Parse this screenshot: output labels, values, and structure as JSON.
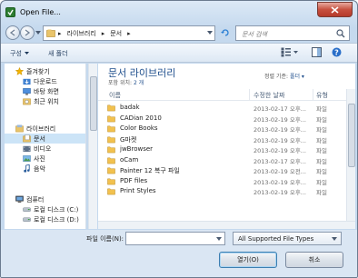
{
  "window": {
    "title": "Open File..."
  },
  "nav": {
    "breadcrumb": [
      "라이브러리",
      "문서"
    ],
    "search_placeholder": "문서 검색"
  },
  "toolbar": {
    "organize_label": "구성",
    "new_folder_label": "새 폴더"
  },
  "sidebar": {
    "favorites": {
      "header": "즐겨찾기",
      "items": [
        "다운로드",
        "바탕 화면",
        "최근 위치"
      ]
    },
    "libraries": {
      "header": "라이브러리",
      "items": [
        "문서",
        "비디오",
        "사진",
        "음악"
      ]
    },
    "computer": {
      "header": "컴퓨터",
      "items": [
        "로컬 디스크 (C:)",
        "로컬 디스크 (D:)"
      ]
    }
  },
  "main": {
    "library_title": "문서 라이브러리",
    "include_label": "포함 위치:",
    "include_value": "2 개",
    "arrange_label": "정렬 기준:",
    "arrange_value": "폴더",
    "columns": {
      "name": "이름",
      "date": "수정한 날짜",
      "type": "유형"
    },
    "files": [
      {
        "name": "badak",
        "date": "2013-02-17 오후...",
        "type": "파일"
      },
      {
        "name": "CADian 2010",
        "date": "2013-02-19 오후...",
        "type": "파일"
      },
      {
        "name": "Color Books",
        "date": "2013-02-19 오후...",
        "type": "파일"
      },
      {
        "name": "G마켓",
        "date": "2013-02-19 오후...",
        "type": "파일"
      },
      {
        "name": "jwBrowser",
        "date": "2013-02-19 오후...",
        "type": "파일"
      },
      {
        "name": "oCam",
        "date": "2013-02-17 오후...",
        "type": "파일"
      },
      {
        "name": "Painter 12 복구 파일",
        "date": "2013-02-19 오전...",
        "type": "파일"
      },
      {
        "name": "PDF files",
        "date": "2013-02-19 오후...",
        "type": "파일"
      },
      {
        "name": "Print Styles",
        "date": "2013-02-19 오후...",
        "type": "파일"
      }
    ]
  },
  "footer": {
    "filename_label": "파일 이름(N):",
    "filename_value": "",
    "filetype_value": "All Supported File Types",
    "open_label": "열기(O)",
    "cancel_label": "취소"
  },
  "colors": {
    "title_blue": "#1e4e8c",
    "selection": "#cce4f7",
    "folder_yellow": "#f2c14e",
    "close_red": "#c7503f"
  }
}
